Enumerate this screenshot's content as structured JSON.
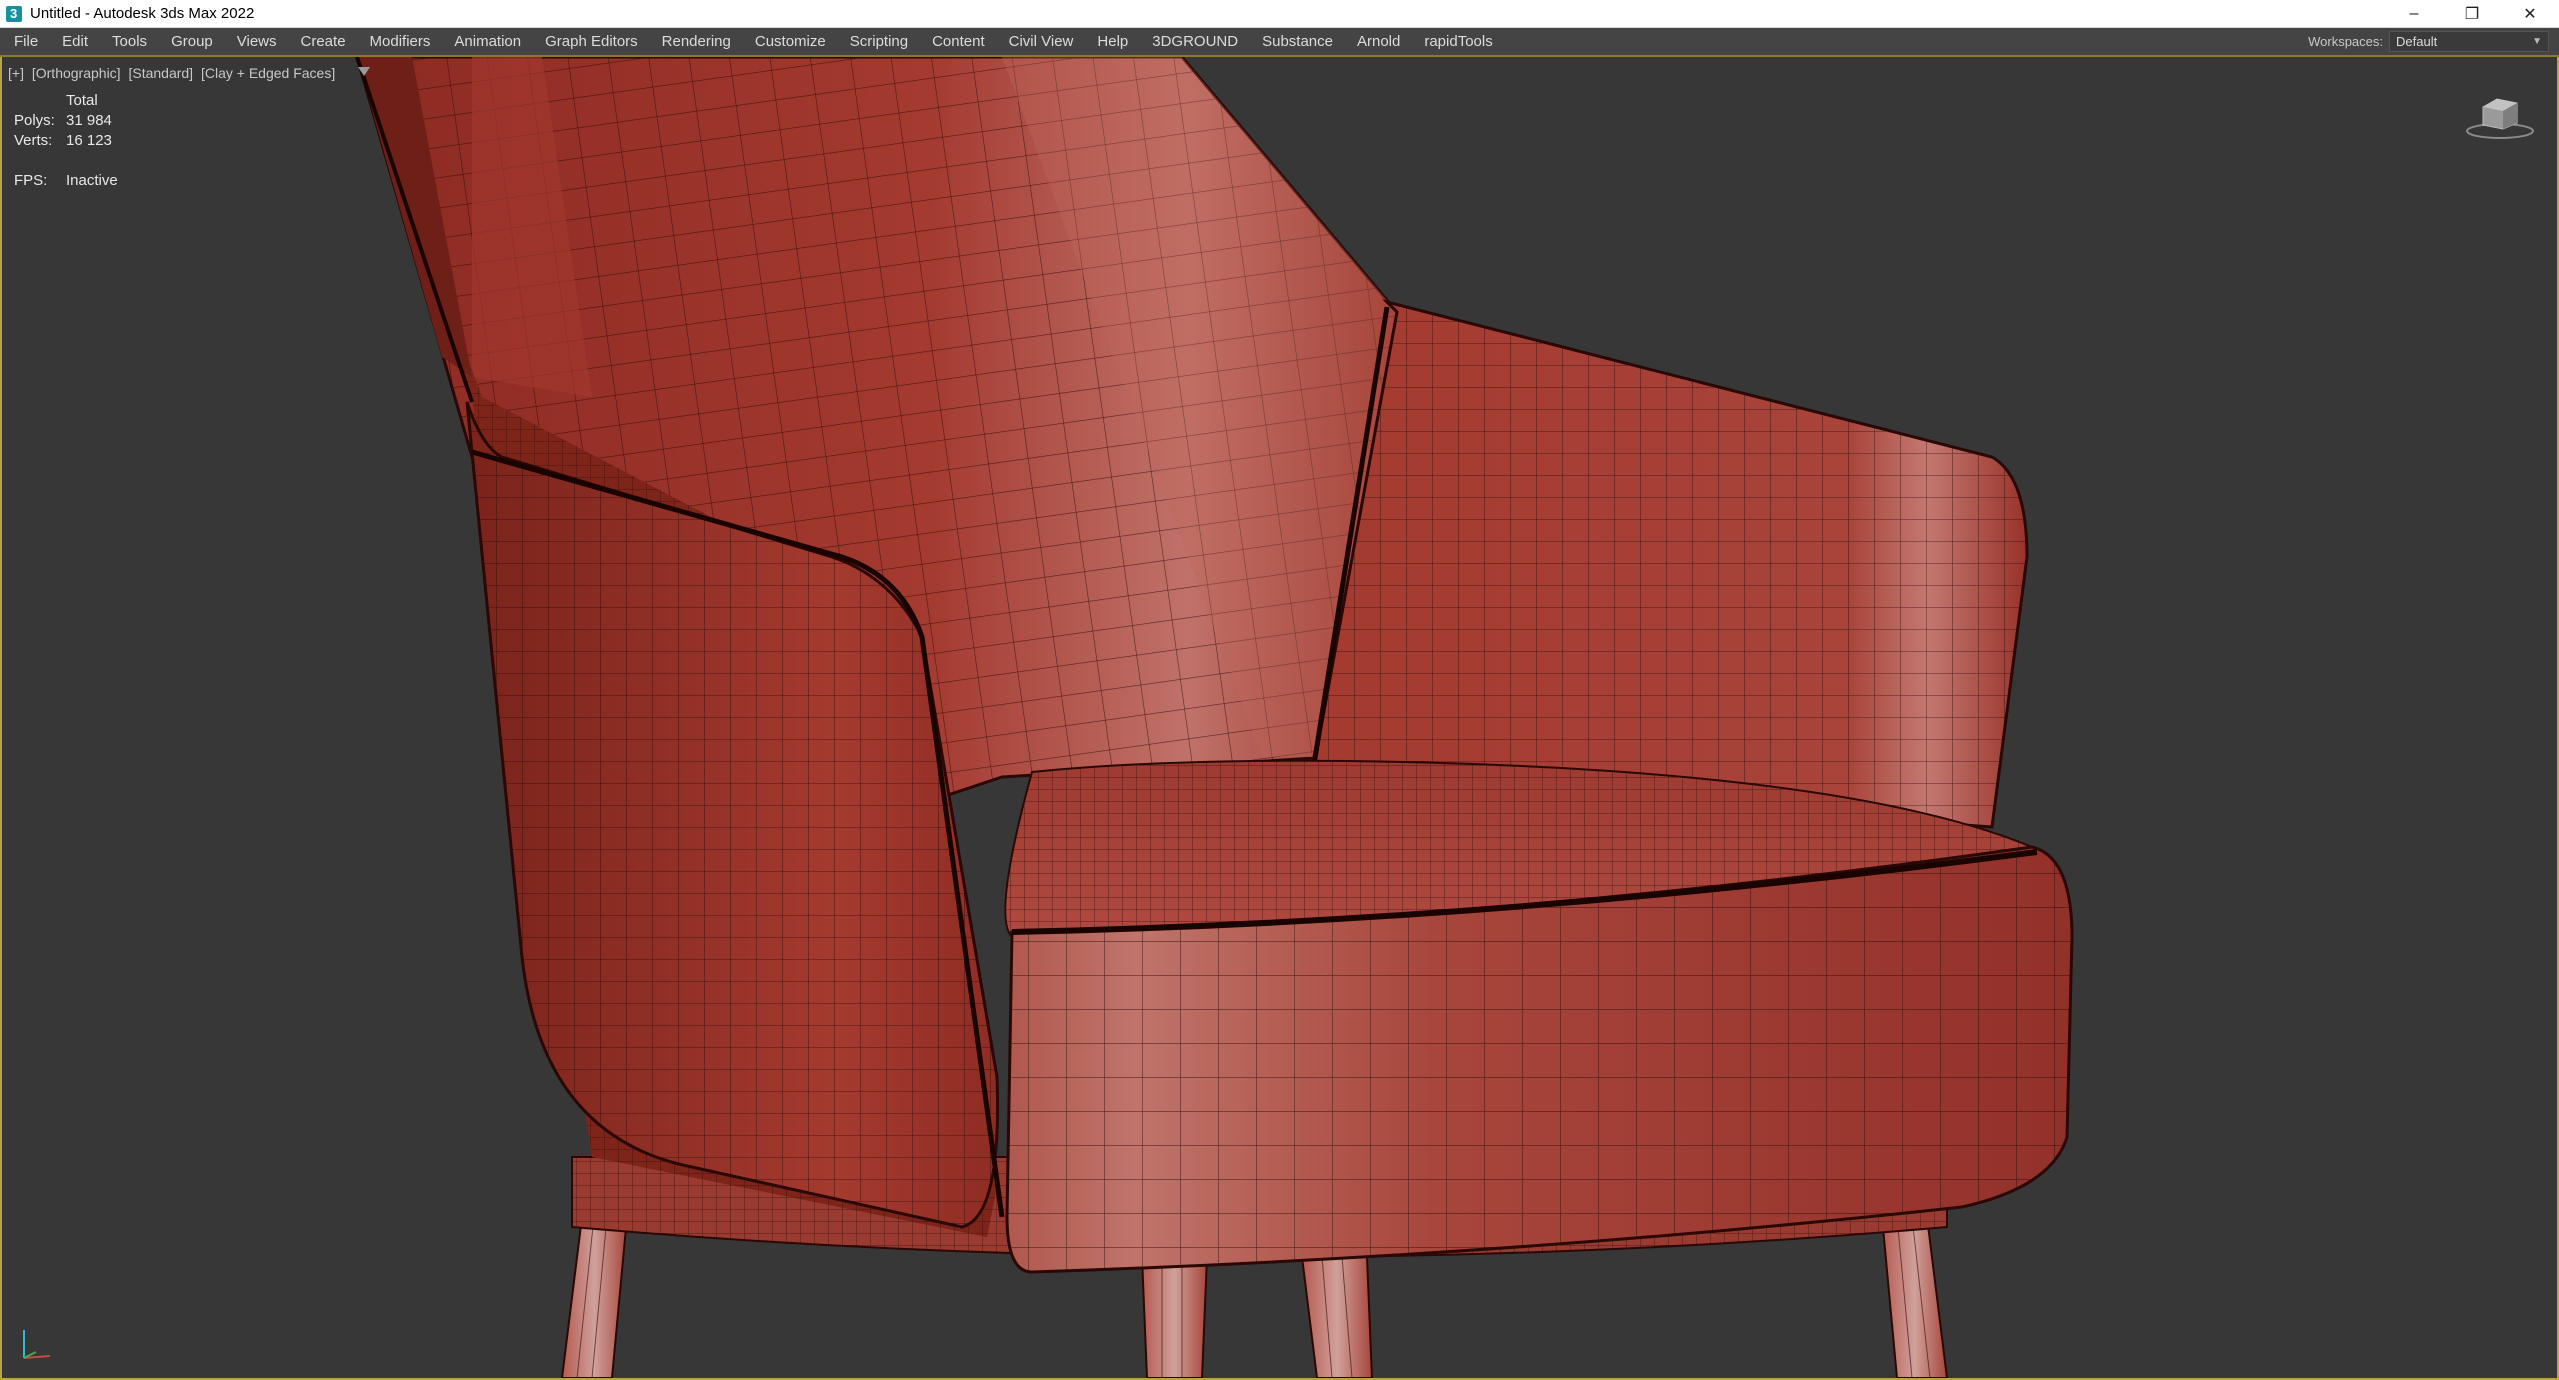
{
  "window": {
    "title": "Untitled - Autodesk 3ds Max 2022",
    "controls": {
      "minimize": "–",
      "restore": "❐",
      "close": "✕"
    }
  },
  "menu": {
    "items": [
      "File",
      "Edit",
      "Tools",
      "Group",
      "Views",
      "Create",
      "Modifiers",
      "Animation",
      "Graph Editors",
      "Rendering",
      "Customize",
      "Scripting",
      "Content",
      "Civil View",
      "Help",
      "3DGROUND",
      "Substance",
      "Arnold",
      "rapidTools"
    ],
    "workspace_label": "Workspaces:",
    "workspace_value": "Default"
  },
  "viewport": {
    "labels": [
      "[+]",
      "[Orthographic]",
      "[Standard]",
      "[Clay + Edged Faces]"
    ],
    "stats": {
      "header": "Total",
      "polys_label": "Polys:",
      "polys_value": "31 984",
      "verts_label": "Verts:",
      "verts_value": "16 123",
      "fps_label": "FPS:",
      "fps_value": "Inactive"
    },
    "colors": {
      "background": "#373737",
      "clay": "#a8382e",
      "clay_dark": "#6e1f18",
      "wire": "#2a0806",
      "active_border": "#b8a24a"
    }
  }
}
